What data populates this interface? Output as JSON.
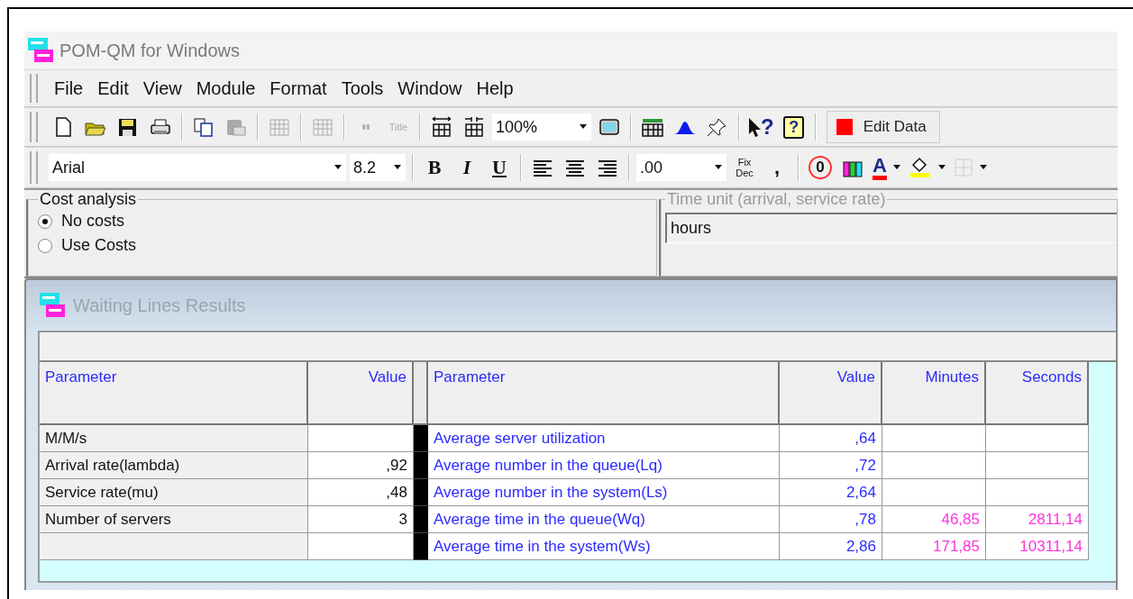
{
  "window": {
    "title": "POM-QM for Windows"
  },
  "menu": [
    "File",
    "Edit",
    "View",
    "Module",
    "Format",
    "Tools",
    "Window",
    "Help"
  ],
  "toolbar": {
    "title_tool": "Title",
    "zoom": "100%",
    "help_glyphs": [
      "?",
      "?"
    ],
    "edit_button": "Edit Data"
  },
  "format_bar": {
    "font": "Arial",
    "size": "8.2",
    "style_buttons": [
      "B",
      "I",
      "U"
    ],
    "number_format": ".00",
    "fix_dec": [
      "Fix",
      "Dec"
    ],
    "comma": ",",
    "zero_glyph": "0",
    "font_color_glyph": "A"
  },
  "cost_analysis": {
    "label": "Cost analysis",
    "options": [
      {
        "label": "No costs",
        "selected": true
      },
      {
        "label": "Use Costs",
        "selected": false
      }
    ]
  },
  "time_unit": {
    "label": "Time unit (arrival, service rate)",
    "value": "hours",
    "disabled": true
  },
  "results": {
    "title": "Waiting Lines Results",
    "left_columns": [
      "Parameter",
      "Value"
    ],
    "right_columns": [
      "Parameter",
      "Value",
      "Minutes",
      "Seconds"
    ],
    "left_rows": [
      {
        "parameter": "M/M/s"
      },
      {
        "parameter": "Arrival rate(lambda)",
        "value": ",92"
      },
      {
        "parameter": "Service rate(mu)",
        "value": ",48"
      },
      {
        "parameter": "Number of servers",
        "value": "3"
      },
      {}
    ],
    "right_rows": [
      {
        "parameter": "Average server utilization",
        "value": ",64"
      },
      {
        "parameter": "Average number in the queue(Lq)",
        "value": ",72"
      },
      {
        "parameter": "Average number in the system(Ls)",
        "value": "2,64"
      },
      {
        "parameter": "Average time in the queue(Wq)",
        "value": ",78",
        "minutes": "46,85",
        "seconds": "2811,14"
      },
      {
        "parameter": "Average time in the system(Ws)",
        "value": "2,86",
        "minutes": "171,85",
        "seconds": "10311,14"
      }
    ]
  }
}
